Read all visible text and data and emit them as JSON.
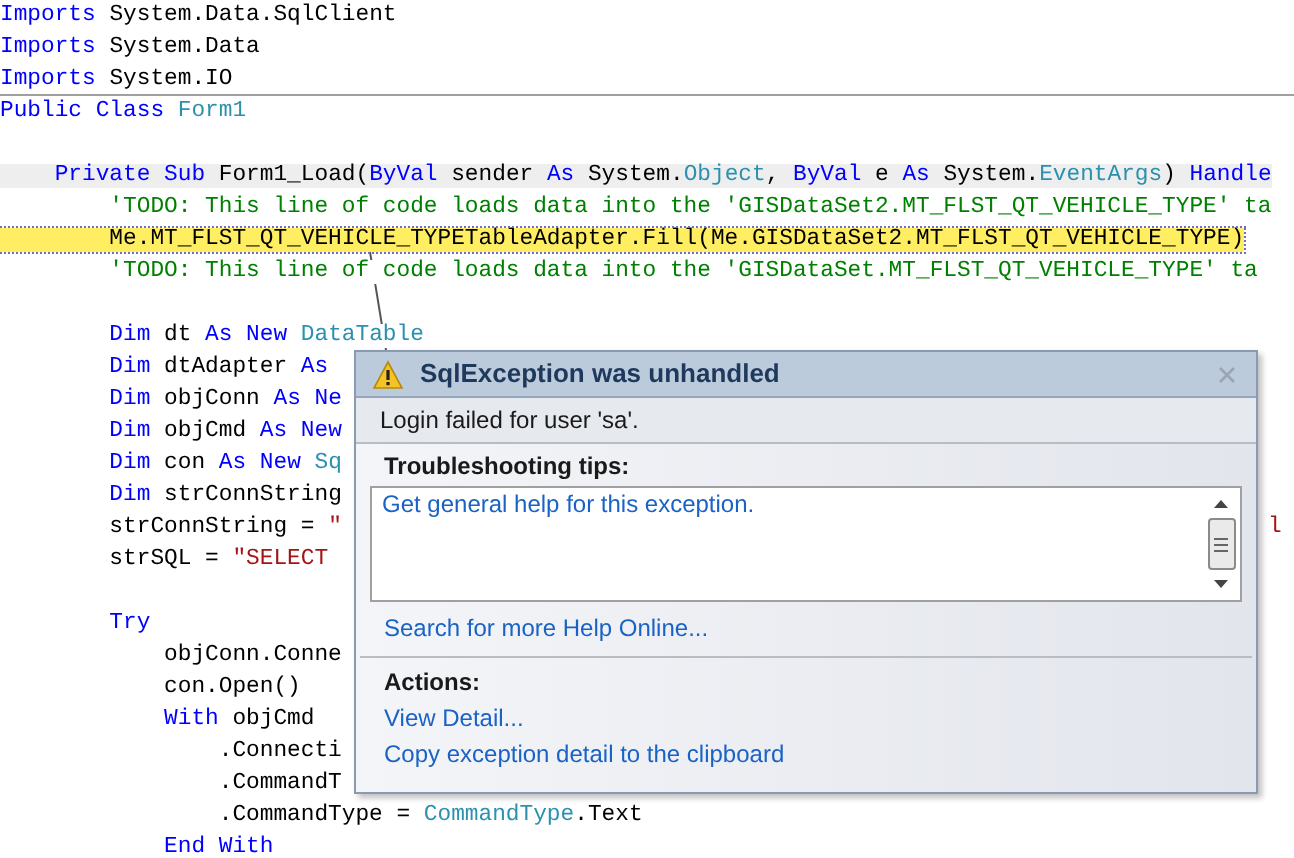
{
  "code": {
    "lines": [
      {
        "kind": "plain",
        "tokens": [
          {
            "text": "Imports",
            "kind": "keyword"
          },
          {
            "text": " System.Data.SqlClient",
            "kind": "plain"
          }
        ]
      },
      {
        "kind": "plain",
        "tokens": [
          {
            "text": "Imports",
            "kind": "keyword"
          },
          {
            "text": " System.Data",
            "kind": "plain"
          }
        ]
      },
      {
        "kind": "plain",
        "tokens": [
          {
            "text": "Imports",
            "kind": "keyword"
          },
          {
            "text": " System.IO",
            "kind": "plain"
          }
        ]
      },
      {
        "kind": "plain",
        "tokens": [
          {
            "text": "Public Class ",
            "kind": "keyword"
          },
          {
            "text": "Form1",
            "kind": "type"
          }
        ]
      },
      {
        "kind": "plain"
      },
      {
        "kind": "member",
        "tokens": [
          {
            "text": "    Private Sub",
            "kind": "keyword"
          },
          {
            "text": " Form1_Load(",
            "kind": "plain"
          },
          {
            "text": "ByVal",
            "kind": "keyword"
          },
          {
            "text": " sender ",
            "kind": "plain"
          },
          {
            "text": "As",
            "kind": "keyword"
          },
          {
            "text": " System.",
            "kind": "plain"
          },
          {
            "text": "Object",
            "kind": "type"
          },
          {
            "text": ", ",
            "kind": "plain"
          },
          {
            "text": "ByVal",
            "kind": "keyword"
          },
          {
            "text": " e ",
            "kind": "plain"
          },
          {
            "text": "As",
            "kind": "keyword"
          },
          {
            "text": " System.",
            "kind": "plain"
          },
          {
            "text": "EventArgs",
            "kind": "type"
          },
          {
            "text": ") ",
            "kind": "plain"
          },
          {
            "text": "Handle",
            "kind": "keyword"
          }
        ]
      },
      {
        "kind": "plain",
        "tokens": [
          {
            "text": "        'TODO: This line of code loads data into the 'GISDataSet2.MT_FLST_QT_VEHICLE_TYPE' ta",
            "kind": "comment"
          }
        ]
      },
      {
        "kind": "current",
        "tokens": [
          {
            "text": "        Me.MT_FLST_QT_VEHICLE_TYPETableAdapter.Fill(Me.GISDataSet2.MT_FLST_QT_VEHICLE_TYPE)",
            "kind": "plain"
          }
        ]
      },
      {
        "kind": "plain",
        "tokens": [
          {
            "text": "        'TODO: This line of code loads data into the 'GISDataSet.MT_FLST_QT_VEHICLE_TYPE' ta",
            "kind": "comment"
          }
        ]
      },
      {
        "kind": "plain"
      },
      {
        "kind": "plain",
        "tokens": [
          {
            "text": "        Dim",
            "kind": "keyword"
          },
          {
            "text": " dt ",
            "kind": "plain"
          },
          {
            "text": "As New ",
            "kind": "keyword"
          },
          {
            "text": "DataTable",
            "kind": "type"
          }
        ]
      },
      {
        "kind": "plain",
        "tokens": [
          {
            "text": "        Dim",
            "kind": "keyword"
          },
          {
            "text": " dtAdapter ",
            "kind": "plain"
          },
          {
            "text": "As",
            "kind": "keyword"
          }
        ]
      },
      {
        "kind": "plain",
        "tokens": [
          {
            "text": "        Dim",
            "kind": "keyword"
          },
          {
            "text": " objConn ",
            "kind": "plain"
          },
          {
            "text": "As Ne",
            "kind": "keyword"
          }
        ]
      },
      {
        "kind": "plain",
        "tokens": [
          {
            "text": "        Dim",
            "kind": "keyword"
          },
          {
            "text": " objCmd ",
            "kind": "plain"
          },
          {
            "text": "As New",
            "kind": "keyword"
          }
        ]
      },
      {
        "kind": "plain",
        "tokens": [
          {
            "text": "        Dim",
            "kind": "keyword"
          },
          {
            "text": " con ",
            "kind": "plain"
          },
          {
            "text": "As New ",
            "kind": "keyword"
          },
          {
            "text": "Sq",
            "kind": "type"
          }
        ]
      },
      {
        "kind": "plain",
        "tokens": [
          {
            "text": "        Dim",
            "kind": "keyword"
          },
          {
            "text": " strConnString",
            "kind": "plain"
          }
        ]
      },
      {
        "kind": "plain",
        "tokens": [
          {
            "text": "        strConnString = ",
            "kind": "plain"
          },
          {
            "text": "\"",
            "kind": "string"
          }
        ],
        "tail": [
          {
            "text": "l",
            "kind": "string"
          }
        ]
      },
      {
        "kind": "plain",
        "tokens": [
          {
            "text": "        strSQL = ",
            "kind": "plain"
          },
          {
            "text": "\"SELECT",
            "kind": "string"
          }
        ]
      },
      {
        "kind": "plain"
      },
      {
        "kind": "plain",
        "tokens": [
          {
            "text": "        Try",
            "kind": "keyword"
          }
        ]
      },
      {
        "kind": "plain",
        "tokens": [
          {
            "text": "            objConn.Conne",
            "kind": "plain"
          }
        ]
      },
      {
        "kind": "plain",
        "tokens": [
          {
            "text": "            con.Open()",
            "kind": "plain"
          }
        ]
      },
      {
        "kind": "plain",
        "tokens": [
          {
            "text": "            With",
            "kind": "keyword"
          },
          {
            "text": " objCmd",
            "kind": "plain"
          }
        ]
      },
      {
        "kind": "plain",
        "tokens": [
          {
            "text": "                .Connecti",
            "kind": "plain"
          }
        ]
      },
      {
        "kind": "plain",
        "tokens": [
          {
            "text": "                .CommandT",
            "kind": "plain"
          }
        ]
      },
      {
        "kind": "plain",
        "tokens": [
          {
            "text": "                .CommandType = ",
            "kind": "plain"
          },
          {
            "text": "CommandType",
            "kind": "type"
          },
          {
            "text": ".Text",
            "kind": "plain"
          }
        ]
      },
      {
        "kind": "plain",
        "tokens": [
          {
            "text": "            End With",
            "kind": "keyword"
          }
        ]
      }
    ]
  },
  "dialog": {
    "title": "SqlException was unhandled",
    "message": "Login failed for user 'sa'.",
    "tips_heading": "Troubleshooting tips:",
    "tips": [
      "Get general help for this exception."
    ],
    "search_link": "Search for more Help Online...",
    "actions_heading": "Actions:",
    "actions": [
      "View Detail...",
      "Copy exception detail to the clipboard"
    ]
  }
}
